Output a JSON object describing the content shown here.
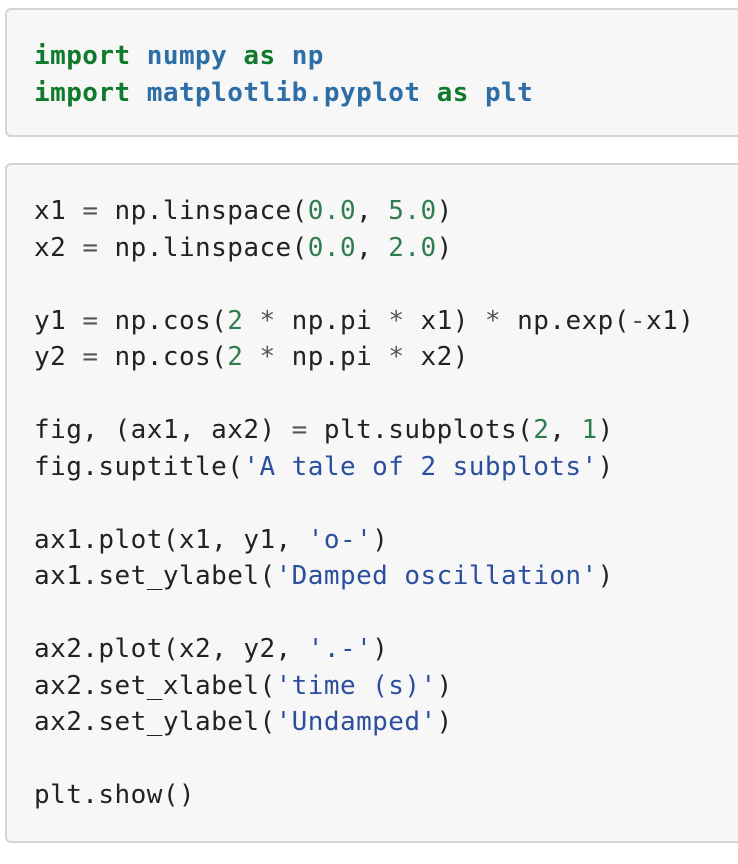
{
  "cells": [
    {
      "lines": [
        [
          {
            "t": "import",
            "c": "kw"
          },
          {
            "t": " "
          },
          {
            "t": "numpy",
            "c": "mod"
          },
          {
            "t": " "
          },
          {
            "t": "as",
            "c": "kw"
          },
          {
            "t": " "
          },
          {
            "t": "np",
            "c": "mod"
          }
        ],
        [
          {
            "t": "import",
            "c": "kw"
          },
          {
            "t": " "
          },
          {
            "t": "matplotlib.pyplot",
            "c": "mod"
          },
          {
            "t": " "
          },
          {
            "t": "as",
            "c": "kw"
          },
          {
            "t": " "
          },
          {
            "t": "plt",
            "c": "mod"
          }
        ]
      ]
    },
    {
      "lines": [
        [
          {
            "t": "x1 "
          },
          {
            "t": "=",
            "c": "op"
          },
          {
            "t": " np.linspace("
          },
          {
            "t": "0.0",
            "c": "num"
          },
          {
            "t": ", "
          },
          {
            "t": "5.0",
            "c": "num"
          },
          {
            "t": ")"
          }
        ],
        [
          {
            "t": "x2 "
          },
          {
            "t": "=",
            "c": "op"
          },
          {
            "t": " np.linspace("
          },
          {
            "t": "0.0",
            "c": "num"
          },
          {
            "t": ", "
          },
          {
            "t": "2.0",
            "c": "num"
          },
          {
            "t": ")"
          }
        ],
        [],
        [
          {
            "t": "y1 "
          },
          {
            "t": "=",
            "c": "op"
          },
          {
            "t": " np.cos("
          },
          {
            "t": "2",
            "c": "num"
          },
          {
            "t": " "
          },
          {
            "t": "*",
            "c": "op"
          },
          {
            "t": " np.pi "
          },
          {
            "t": "*",
            "c": "op"
          },
          {
            "t": " x1) "
          },
          {
            "t": "*",
            "c": "op"
          },
          {
            "t": " np.exp("
          },
          {
            "t": "-",
            "c": "op"
          },
          {
            "t": "x1)"
          }
        ],
        [
          {
            "t": "y2 "
          },
          {
            "t": "=",
            "c": "op"
          },
          {
            "t": " np.cos("
          },
          {
            "t": "2",
            "c": "num"
          },
          {
            "t": " "
          },
          {
            "t": "*",
            "c": "op"
          },
          {
            "t": " np.pi "
          },
          {
            "t": "*",
            "c": "op"
          },
          {
            "t": " x2)"
          }
        ],
        [],
        [
          {
            "t": "fig, (ax1, ax2) "
          },
          {
            "t": "=",
            "c": "op"
          },
          {
            "t": " plt.subplots("
          },
          {
            "t": "2",
            "c": "num"
          },
          {
            "t": ", "
          },
          {
            "t": "1",
            "c": "num"
          },
          {
            "t": ")"
          }
        ],
        [
          {
            "t": "fig.suptitle("
          },
          {
            "t": "'A tale of 2 subplots'",
            "c": "str"
          },
          {
            "t": ")"
          }
        ],
        [],
        [
          {
            "t": "ax1.plot(x1, y1, "
          },
          {
            "t": "'o-'",
            "c": "str"
          },
          {
            "t": ")"
          }
        ],
        [
          {
            "t": "ax1.set_ylabel("
          },
          {
            "t": "'Damped oscillation'",
            "c": "str"
          },
          {
            "t": ")"
          }
        ],
        [],
        [
          {
            "t": "ax2.plot(x2, y2, "
          },
          {
            "t": "'.-'",
            "c": "str"
          },
          {
            "t": ")"
          }
        ],
        [
          {
            "t": "ax2.set_xlabel("
          },
          {
            "t": "'time (s)'",
            "c": "str"
          },
          {
            "t": ")"
          }
        ],
        [
          {
            "t": "ax2.set_ylabel("
          },
          {
            "t": "'Undamped'",
            "c": "str"
          },
          {
            "t": ")"
          }
        ],
        [],
        [
          {
            "t": "plt.show()"
          }
        ]
      ]
    }
  ],
  "colors": {
    "keyword": "#0f7a2b",
    "module": "#2d6ea6",
    "number": "#2f7d4f",
    "string": "#2b4f9e",
    "text": "#222222",
    "cell_background": "#f7f7f7",
    "cell_border": "#d4d4d4"
  }
}
